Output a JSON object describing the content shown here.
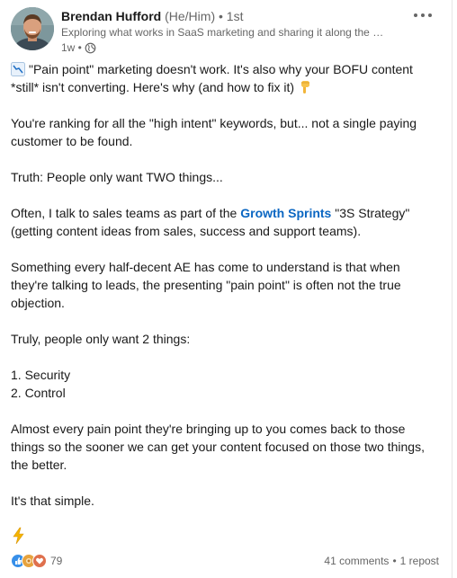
{
  "post": {
    "author": {
      "name": "Brendan Hufford",
      "pronouns": "(He/Him)",
      "degree": "• 1st",
      "headline": "Exploring what works in SaaS marketing and sharing it along the way",
      "time": "1w •"
    },
    "menu_icon": "more-horizontal-icon",
    "visibility_icon": "globe-icon",
    "paragraphs": {
      "p1_a": "\"Pain point\" marketing doesn't work. It's also why your BOFU content *still* isn't converting. Here's why (and how to fix it)",
      "p2": "You're ranking for all the \"high intent\" keywords, but... not a single paying customer to be found.",
      "p3": "Truth: People only want TWO things...",
      "p4_a": "Often, I talk to sales teams as part of the ",
      "p4_mention": "Growth Sprints",
      "p4_b": " \"3S Strategy\" (getting content ideas from sales, success and support teams).",
      "p5": "Something every half-decent AE has come to understand is that when they're talking to leads, the presenting \"pain point\" is often not the true objection.",
      "p6": "Truly, people only want 2 things:",
      "list_1": "1. Security",
      "list_2": "2. Control",
      "p7": "Almost every pain point they're bringing up to you comes back to those things so the sooner we can get your content focused on those two things, the better.",
      "p8": "It's that simple."
    },
    "emojis": [
      "chart-decreasing-emoji",
      "backhand-index-pointing-down-emoji",
      "lightning-emoji"
    ],
    "social": {
      "reaction_icons": [
        "like-icon",
        "support-icon",
        "love-icon"
      ],
      "reaction_count": "79",
      "comments": "41 comments",
      "separator": "•",
      "reposts": "1 repost"
    },
    "colors": {
      "link_blue": "#0a66c2",
      "text": "#191919",
      "muted": "#666666"
    }
  }
}
